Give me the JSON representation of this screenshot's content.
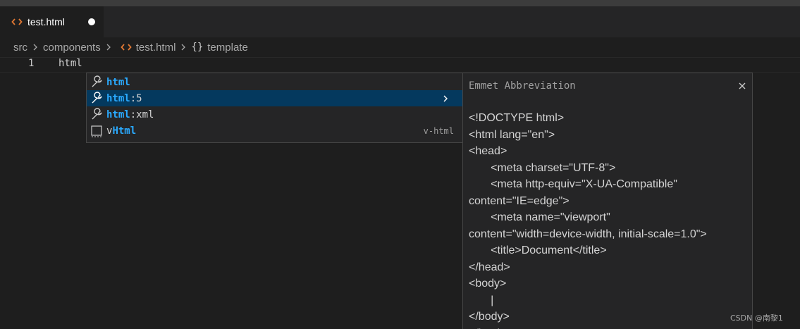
{
  "tab": {
    "label": "test.html",
    "icon": "html-file-icon",
    "modified": true,
    "accent": "#e37933"
  },
  "breadcrumb": {
    "items": [
      "src",
      "components",
      "test.html",
      "template"
    ],
    "curly": "{}"
  },
  "editor": {
    "line_number": "1",
    "line_text": "html"
  },
  "suggest": {
    "items": [
      {
        "match": "html",
        "rest": "",
        "icon": "wrench-icon",
        "detail": ""
      },
      {
        "match": "html",
        "rest": ":5",
        "icon": "wrench-icon",
        "detail": "",
        "selected": true
      },
      {
        "match": "html",
        "rest": ":xml",
        "icon": "wrench-icon",
        "detail": ""
      },
      {
        "pre": "v",
        "match": "Html",
        "rest": "",
        "icon": "snippet-icon",
        "detail": "v-html"
      }
    ],
    "highlight_color": "#2aaaff",
    "selected_bg": "#04395e"
  },
  "details": {
    "title": "Emmet Abbreviation",
    "body": "<!DOCTYPE html>\n<html lang=\"en\">\n<head>\n       <meta charset=\"UTF-8\">\n       <meta http-equiv=\"X-UA-Compatible\"\ncontent=\"IE=edge\">\n       <meta name=\"viewport\"\ncontent=\"width=device-width, initial-scale=1.0\">\n       <title>Document</title>\n</head>\n<body>\n       |\n</body>\n</html>"
  },
  "watermark": "CSDN @南黎1"
}
